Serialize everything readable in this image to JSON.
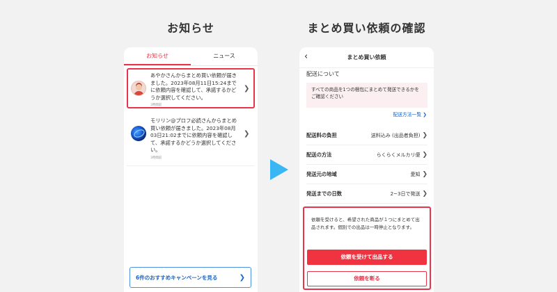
{
  "headings": {
    "left": "お知らせ",
    "right": "まとめ買い依頼の確認"
  },
  "left_phone": {
    "tabs": [
      {
        "label": "お知らせ",
        "active": true
      },
      {
        "label": "ニュース",
        "active": false
      }
    ],
    "notifications": [
      {
        "text": "あやかさんからまとめ買い依頼が届きました。2023年08月11日15:24までに依頼内容を確認して、承諾するかどうか選択してください。",
        "time": "3時間前",
        "highlighted": true
      },
      {
        "text": "モリリン@プロフ必読さんからまとめ買い依頼が届きました。2023年08月03日21:02までに依頼内容を確認して、承諾するかどうか選択してください。",
        "time": "3時間前",
        "highlighted": false
      }
    ],
    "campaign_button": "6件のおすすめキャンペーンを見る"
  },
  "right_phone": {
    "title": "まとめ買い依頼",
    "section_label": "配送について",
    "info_box": "すべての商品を1つの梱包にまとめて発送できるかをご確認ください",
    "method_link": "配送方法一覧",
    "rows": [
      {
        "label": "配送料の負担",
        "value": "送料込み (出品者負担)"
      },
      {
        "label": "配送の方法",
        "value": "らくらくメルカリ便"
      },
      {
        "label": "発送元の地域",
        "value": "愛知"
      },
      {
        "label": "発送までの日数",
        "value": "2~3日で発送"
      }
    ],
    "notice_text": "依頼を受けると、希望された商品が１つにまとめて出品されます。個別での出品は一時停止となります。",
    "accept_button": "依頼を受けて出品する",
    "decline_button": "依頼を断る"
  },
  "colors": {
    "accent_red": "#e8344a",
    "link_blue": "#1a64c8",
    "arrow_blue": "#39b6f4"
  }
}
